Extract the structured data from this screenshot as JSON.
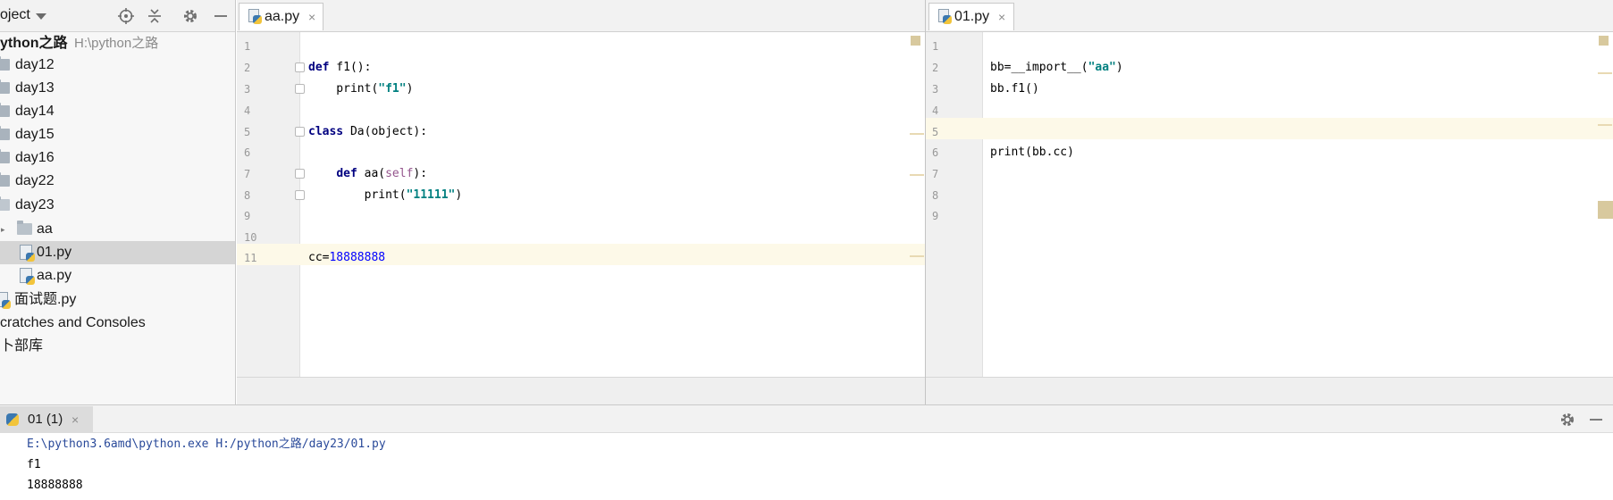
{
  "project_panel": {
    "title": "oject",
    "root": {
      "name": "ython之路",
      "path": "H:\\python之路"
    },
    "tree": [
      {
        "label": "day12",
        "kind": "folder"
      },
      {
        "label": "day13",
        "kind": "folder"
      },
      {
        "label": "day14",
        "kind": "folder"
      },
      {
        "label": "day15",
        "kind": "folder"
      },
      {
        "label": "day16",
        "kind": "folder"
      },
      {
        "label": "day22",
        "kind": "folder"
      },
      {
        "label": "day23",
        "kind": "folder"
      },
      {
        "label": "aa",
        "kind": "package"
      },
      {
        "label": "01.py",
        "kind": "file",
        "selected": true
      },
      {
        "label": "aa.py",
        "kind": "file"
      },
      {
        "label": "面试题.py",
        "kind": "file"
      },
      {
        "label": "cratches and Consoles",
        "kind": "node"
      },
      {
        "label": "卜部库",
        "kind": "node"
      }
    ]
  },
  "editor_left": {
    "tab_label": "aa.py",
    "tab_close": "×",
    "line_numbers": [
      "1",
      "2",
      "3",
      "4",
      "5",
      "6",
      "7",
      "8",
      "9",
      "10",
      "11"
    ],
    "lines": [
      "",
      "def f1():",
      "    print(\"f1\")",
      "",
      "class Da(object):",
      "",
      "    def aa(self):",
      "        print(\"11111\")",
      "",
      "",
      "cc=18888888"
    ]
  },
  "editor_right": {
    "tab_label": "01.py",
    "tab_close": "×",
    "line_numbers": [
      "1",
      "2",
      "3",
      "4",
      "5",
      "6",
      "7",
      "8",
      "9"
    ],
    "lines": [
      "",
      "bb=__import__(\"aa\")",
      "bb.f1()",
      "",
      "",
      "print(bb.cc)",
      "",
      "",
      ""
    ]
  },
  "run_panel": {
    "tab_label": "01 (1)",
    "tab_close": "×",
    "output": [
      "E:\\python3.6amd\\python.exe H:/python之路/day23/01.py",
      "f1",
      "18888888"
    ]
  },
  "colors": {
    "keyword": "#000080",
    "string": "#008080",
    "number": "#0000ff",
    "self": "#94558d",
    "caret_line": "#fdf9e8",
    "selection": "#d5d5d5"
  }
}
